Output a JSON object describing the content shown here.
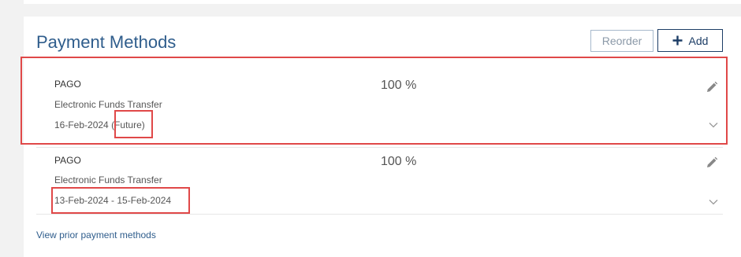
{
  "section": {
    "title": "Payment Methods",
    "reorder_label": "Reorder",
    "add_label": "Add"
  },
  "payment_methods": [
    {
      "name": "PAGO",
      "method": "Electronic Funds Transfer",
      "date": "16-Feb-2024",
      "status": "(Future)",
      "percent": "100 %"
    },
    {
      "name": "PAGO",
      "method": "Electronic Funds Transfer",
      "date": "13-Feb-2024  - 15-Feb-2024",
      "percent": "100 %"
    }
  ],
  "view_prior_label": "View prior payment methods",
  "colors": {
    "title": "#2f5d8c",
    "add_border": "#1c3d66",
    "highlight": "#e04848"
  },
  "icons": [
    "plus-icon",
    "pencil-icon",
    "chevron-down-icon"
  ]
}
